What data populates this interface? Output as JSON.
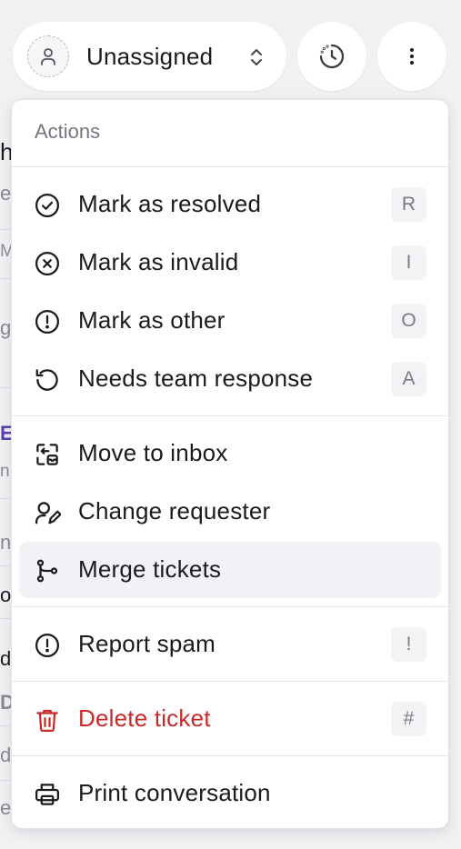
{
  "assignee": {
    "label": "Unassigned"
  },
  "background_fragments": [
    "h",
    "e",
    "Ma",
    "g",
    "E",
    "n",
    "no",
    "or",
    "di",
    "D",
    "d",
    "e"
  ],
  "menu": {
    "heading": "Actions",
    "items": [
      {
        "id": "mark-resolved",
        "label": "Mark as resolved",
        "shortcut": "R",
        "icon": "check-circle-icon"
      },
      {
        "id": "mark-invalid",
        "label": "Mark as invalid",
        "shortcut": "I",
        "icon": "x-circle-icon"
      },
      {
        "id": "mark-other",
        "label": "Mark as other",
        "shortcut": "O",
        "icon": "alert-circle-icon"
      },
      {
        "id": "needs-team-response",
        "label": "Needs team response",
        "shortcut": "A",
        "icon": "rotate-ccw-icon"
      },
      {
        "id": "move-to-inbox",
        "label": "Move to inbox",
        "shortcut": "",
        "icon": "move-inbox-icon"
      },
      {
        "id": "change-requester",
        "label": "Change requester",
        "shortcut": "",
        "icon": "user-edit-icon"
      },
      {
        "id": "merge-tickets",
        "label": "Merge tickets",
        "shortcut": "",
        "icon": "git-merge-icon"
      },
      {
        "id": "report-spam",
        "label": "Report spam",
        "shortcut": "!",
        "icon": "alert-circle-icon"
      },
      {
        "id": "delete-ticket",
        "label": "Delete ticket",
        "shortcut": "#",
        "icon": "trash-icon"
      },
      {
        "id": "print-conversation",
        "label": "Print conversation",
        "shortcut": "",
        "icon": "printer-icon"
      }
    ]
  },
  "colors": {
    "danger": "#c82a2a",
    "highlight": "#f2f2f6",
    "background": "#f1f1f4",
    "accent_fragment": "#5b3fb5"
  }
}
